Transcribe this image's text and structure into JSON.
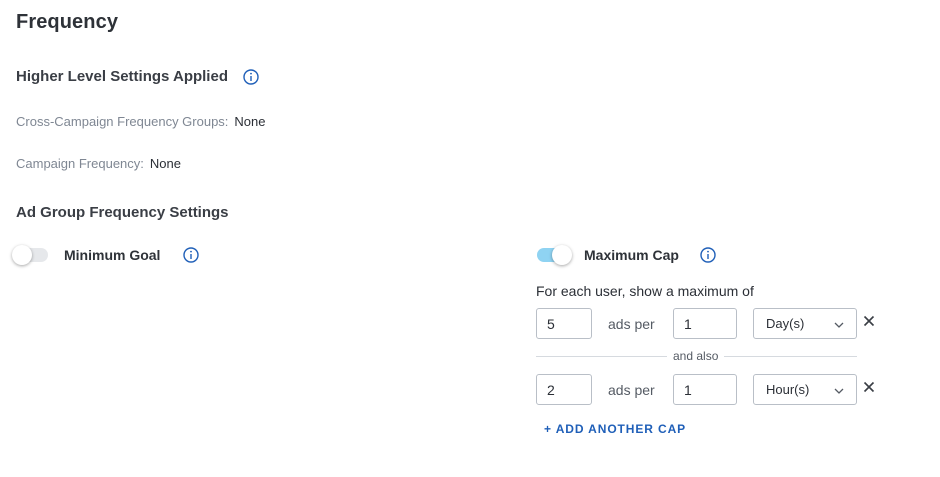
{
  "page_title": "Frequency",
  "higher_level": {
    "title": "Higher Level Settings Applied",
    "rows": [
      {
        "label": "Cross-Campaign Frequency Groups:",
        "value": "None"
      },
      {
        "label": "Campaign Frequency:",
        "value": "None"
      }
    ]
  },
  "ad_group": {
    "title": "Ad Group Frequency Settings",
    "minimum_goal": {
      "label": "Minimum Goal",
      "enabled": false
    },
    "maximum_cap": {
      "label": "Maximum Cap",
      "enabled": true,
      "description": "For each user, show a maximum of",
      "ads_per_label": "ads per",
      "separator": "and also",
      "caps": [
        {
          "count": "5",
          "period_amount": "1",
          "period_unit": "Day(s)"
        },
        {
          "count": "2",
          "period_amount": "1",
          "period_unit": "Hour(s)"
        }
      ],
      "add_label": "+ ADD ANOTHER CAP"
    }
  },
  "colors": {
    "accent": "#1f5fb8",
    "toggle_on": "#8fd3f2",
    "muted_text": "#7f8793"
  },
  "icons": {
    "info": "info-circle-icon",
    "dropdown": "chevron-down-icon",
    "remove": "close-icon"
  }
}
